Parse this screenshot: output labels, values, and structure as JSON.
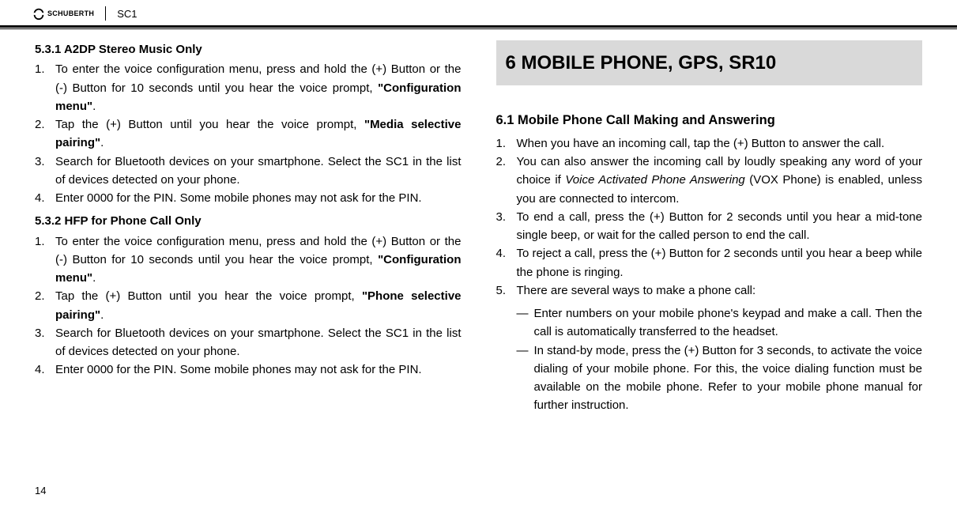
{
  "header": {
    "brand": "SCHUBERTH",
    "model": "SC1"
  },
  "left": {
    "sec531_title": "5.3.1  A2DP Stereo Music Only",
    "sec531_items": [
      {
        "pre": "To enter the voice configuration menu, press and hold the (+) Button or the (-) Button for 10 seconds until you hear the voice prompt, ",
        "bold": "\"Configuration menu\"",
        "post": "."
      },
      {
        "pre": "Tap the (+) Button until you hear the voice prompt, ",
        "bold": "\"Media selective pairing\"",
        "post": "."
      },
      {
        "pre": "Search for Bluetooth devices on your smartphone. Select the SC1 in the list of devices detected on your phone.",
        "bold": "",
        "post": ""
      },
      {
        "pre": "Enter 0000 for the PIN. Some mobile phones may not ask for the PIN.",
        "bold": "",
        "post": ""
      }
    ],
    "sec532_title": "5.3.2  HFP for Phone Call Only",
    "sec532_items": [
      {
        "pre": "To enter the voice configuration menu, press and hold the (+) Button or the (-) Button for 10 seconds until you hear the voice prompt, ",
        "bold": "\"Configuration menu\"",
        "post": "."
      },
      {
        "pre": "Tap the (+) Button until you hear the voice prompt, ",
        "bold": "\"Phone selective pairing\"",
        "post": "."
      },
      {
        "pre": "Search for Bluetooth devices on your smartphone. Select the SC1 in the list of devices detected on your phone.",
        "bold": "",
        "post": ""
      },
      {
        "pre": "Enter 0000 for the PIN. Some mobile phones may not ask for the PIN.",
        "bold": "",
        "post": ""
      }
    ]
  },
  "right": {
    "chapter_title": "6   MOBILE PHONE, GPS, SR10",
    "sec61_title": "6.1   Mobile Phone Call Making and Answering",
    "sec61_items": [
      {
        "text": "When you have an incoming call, tap the (+) Button to answer the call."
      },
      {
        "pre": "You can also answer the incoming call by loudly speaking any word of your choice if ",
        "italic": "Voice Activated Phone Answering",
        "post": " (VOX Phone) is enabled, unless you are connected to intercom."
      },
      {
        "text": "To end a call, press the (+) Button for 2 seconds until you hear a mid-tone single beep, or wait for the called person to end the call."
      },
      {
        "text": "To reject a call, press the (+) Button for 2 seconds until you hear a beep while the phone is ringing."
      },
      {
        "text": "There are several ways to make a phone call:"
      }
    ],
    "sec61_dashes": [
      "Enter numbers on your mobile phone's keypad and make a call. Then the call is automatically transferred to the headset.",
      "In stand-by mode, press the (+) Button for 3 seconds, to activate the voice dialing of your mobile phone. For this, the voice dialing function must be available on the mobile phone. Refer to your mobile phone manual for further instruction."
    ]
  },
  "page_number": "14"
}
